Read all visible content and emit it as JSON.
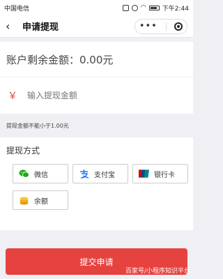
{
  "status_bar": {
    "carrier": "中国电信",
    "time": "下午2:44"
  },
  "nav": {
    "back_glyph": "‹",
    "title": "申请提现",
    "more_glyph": "•••"
  },
  "balance": {
    "label": "账户剩余金额：0.00元"
  },
  "amount": {
    "currency_symbol": "￥",
    "placeholder": "输入提现金额"
  },
  "hint": "提现金额不能小于1.00元",
  "methods": {
    "title": "提现方式",
    "options": [
      {
        "label": "微信",
        "icon": "wechat-icon"
      },
      {
        "label": "支付宝",
        "icon": "alipay-icon"
      },
      {
        "label": "银行卡",
        "icon": "unionpay-icon"
      },
      {
        "label": "余额",
        "icon": "coins-icon"
      }
    ]
  },
  "submit_label": "提交申请",
  "watermark": "百家号/小程序知识平台",
  "colors": {
    "accent": "#e64340",
    "background": "#efeff4",
    "wechat": "#1aad19",
    "alipay": "#1677ff",
    "unionpay": "#d7000f",
    "coins": "#f0a818"
  }
}
